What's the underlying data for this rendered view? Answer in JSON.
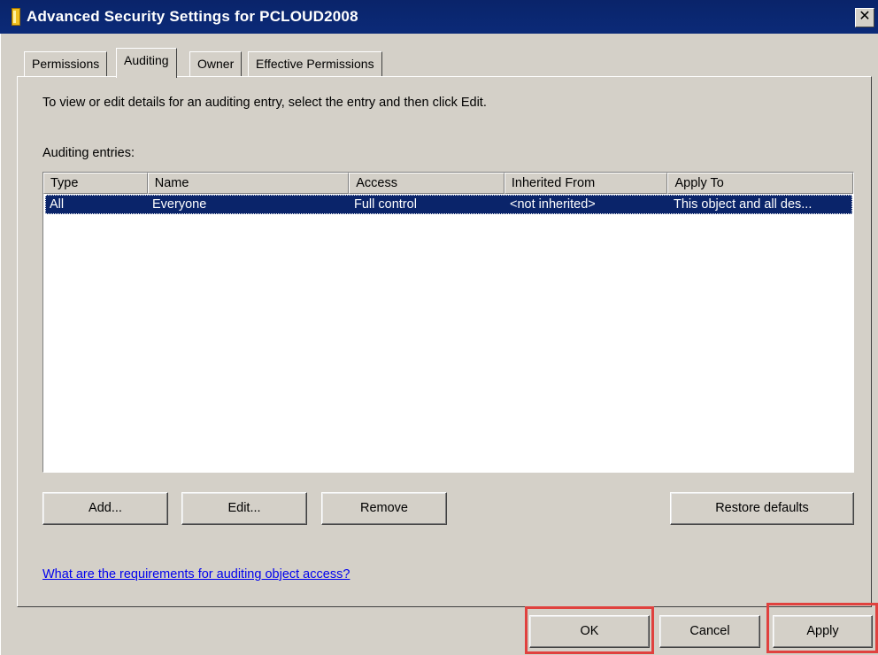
{
  "window": {
    "title": "Advanced Security Settings for PCLOUD2008",
    "close_glyph": "✕"
  },
  "tabs": [
    {
      "label": "Permissions"
    },
    {
      "label": "Auditing"
    },
    {
      "label": "Owner"
    },
    {
      "label": "Effective Permissions"
    }
  ],
  "auditing": {
    "instructions": "To view or edit details for an auditing entry, select the entry and then click Edit.",
    "entries_label": "Auditing entries:",
    "columns": [
      "Type",
      "Name",
      "Access",
      "Inherited From",
      "Apply To"
    ],
    "rows": [
      {
        "type": "All",
        "name": "Everyone",
        "access": "Full control",
        "inherited_from": "<not inherited>",
        "apply_to": "This object and all des..."
      }
    ],
    "buttons": {
      "add": "Add...",
      "edit": "Edit...",
      "remove": "Remove",
      "restore_defaults": "Restore defaults"
    },
    "help_link": "What are the requirements for auditing object access?"
  },
  "footer": {
    "ok": "OK",
    "cancel": "Cancel",
    "apply": "Apply"
  },
  "colors": {
    "titlebar": "#0a246a",
    "dialog": "#d4d0c8",
    "selection": "#0a246a",
    "highlight": "#e0413e",
    "link": "#0000ee"
  }
}
